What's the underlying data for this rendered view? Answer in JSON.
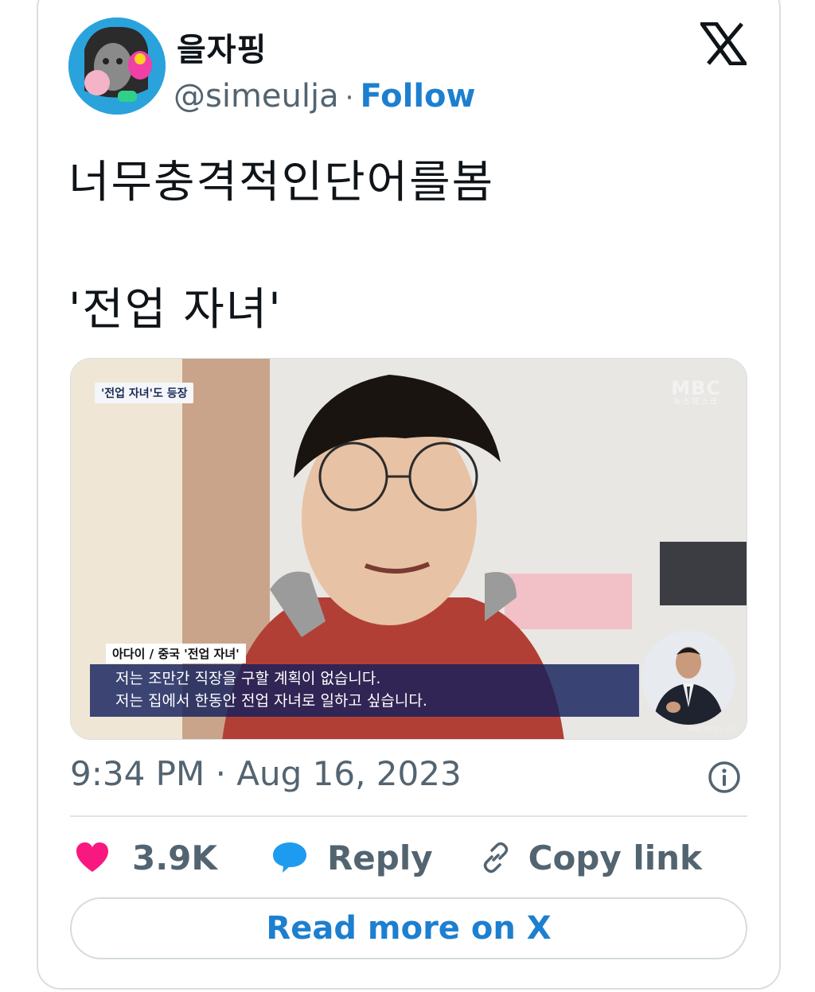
{
  "header": {
    "display_name": "을자핑",
    "handle": "@simeulja",
    "separator": "·",
    "follow_label": "Follow"
  },
  "tweet": {
    "text": "너무충격적인단어를봄\n\n'전업 자녀'"
  },
  "media": {
    "top_tag": "'전업 자녀'도 등장",
    "channel_logo": "MBC",
    "channel_sub": "뉴스데스크",
    "caption_name": "아다이 / 중국 '전업 자녀'",
    "caption_lines": [
      "저는 조만간 직장을 구할 계획이 없습니다.",
      "저는 집에서 한동안 전업 자녀로 일하고 싶습니다."
    ],
    "corner_badge": "MBC NEWS 구독"
  },
  "meta": {
    "timestamp": "9:34 PM · Aug 16, 2023"
  },
  "actions": {
    "like_count": "3.9K",
    "reply_label": "Reply",
    "copy_label": "Copy link"
  },
  "footer": {
    "read_more_label": "Read more on X"
  },
  "colors": {
    "accent_blue": "#1d7fd0",
    "like_pink": "#f91880",
    "muted_text": "#536471"
  },
  "icons": [
    "x-logo-icon",
    "info-icon",
    "heart-icon",
    "reply-bubble-icon",
    "link-icon"
  ]
}
